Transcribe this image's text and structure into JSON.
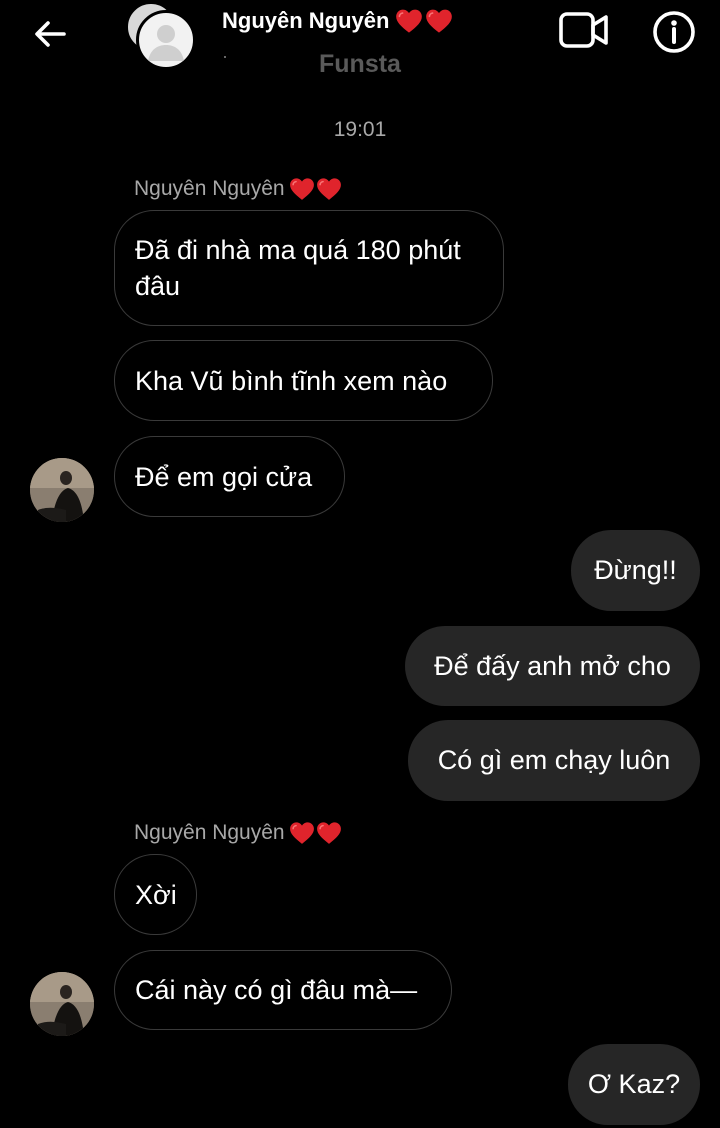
{
  "header": {
    "contact_name": "Nguyên Nguyên",
    "subtitle": "Funsta",
    "heart_icons": [
      "heart-icon",
      "heart-icon"
    ],
    "back_icon": "arrow-left-icon",
    "video_icon": "video-camera-icon",
    "info_icon": "info-icon",
    "heart_color": "#e0242c"
  },
  "conversation": {
    "timestamp": "19:01",
    "groups": [
      {
        "sender": "Nguyên Nguyên",
        "direction": "incoming",
        "messages": [
          "Đã đi nhà ma quá 180 phút đâu",
          "Kha Vũ bình tĩnh xem nào",
          "Để em gọi cửa"
        ]
      },
      {
        "direction": "outgoing",
        "messages": [
          "Đừng!!",
          "Để đấy anh mở cho",
          "Có gì em chạy luôn"
        ]
      },
      {
        "sender": "Nguyên Nguyên",
        "direction": "incoming",
        "messages": [
          "Xời",
          "Cái này có gì đâu mà—"
        ]
      },
      {
        "direction": "outgoing",
        "messages": [
          "Ơ Kaz?"
        ]
      }
    ]
  },
  "colors": {
    "background": "#000000",
    "outgoing_bubble": "#262626",
    "incoming_border": "#3a3a3a",
    "muted_text": "#a8a8a8"
  }
}
